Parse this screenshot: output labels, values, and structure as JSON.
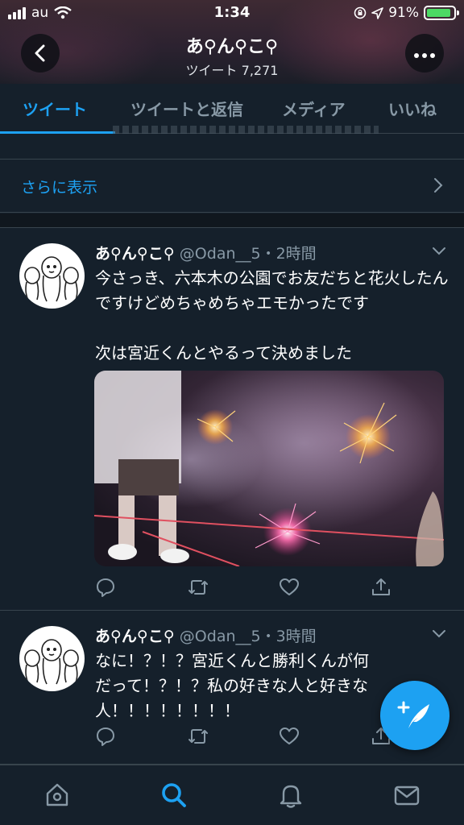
{
  "status_bar": {
    "carrier": "au",
    "time": "1:34",
    "battery_percent": "91%",
    "battery_level": 0.91
  },
  "profile": {
    "name": "あ⚲ん⚲こ⚲",
    "tweet_count": "ツイート 7,271"
  },
  "tabs": [
    {
      "label": "ツイート",
      "active": true
    },
    {
      "label": "ツイートと返信",
      "active": false
    },
    {
      "label": "メディア",
      "active": false
    },
    {
      "label": "いいね",
      "active": false
    }
  ],
  "show_more": {
    "label": "さらに表示"
  },
  "tweets": [
    {
      "author": "あ⚲ん⚲こ⚲",
      "handle_time": "@Odan__5・2時間",
      "text": "今さっき、六本木の公園でお友だちと花火したんですけどめちゃめちゃエモかったです\n\n次は宮近くんとやるって決めました",
      "has_media": true
    },
    {
      "author": "あ⚲ん⚲こ⚲",
      "handle_time": "@Odan__5・3時間",
      "text": "なに！？！？宮近くんと勝利くんが何だって！？！？私の好きな人と好きな人！！！！！！！！",
      "has_media": false
    }
  ],
  "icons": {
    "reply": "reply-icon",
    "retweet": "retweet-icon",
    "like": "like-icon",
    "share": "share-icon",
    "compose": "compose-tweet-icon",
    "home": "home-icon",
    "search": "search-icon",
    "notifications": "bell-icon",
    "messages": "envelope-icon"
  },
  "colors": {
    "accent": "#1da1f2",
    "background": "#15202b",
    "muted": "#8899a6",
    "battery": "#4cd964"
  }
}
